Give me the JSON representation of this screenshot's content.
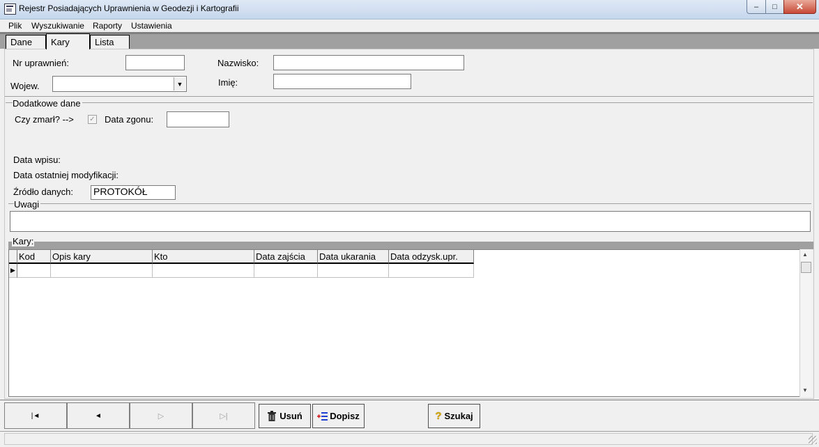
{
  "window": {
    "title": "Rejestr Posiadających Uprawnienia w Geodezji i Kartografii",
    "min": "–",
    "max": "□",
    "close": "✕"
  },
  "menu": [
    "Plik",
    "Wyszukiwanie",
    "Raporty",
    "Ustawienia"
  ],
  "tabs": [
    "Dane",
    "Kary",
    "Lista"
  ],
  "form": {
    "nr_uprawnien_label": "Nr uprawnień:",
    "nr_uprawnien_value": "",
    "nazwisko_label": "Nazwisko:",
    "nazwisko_value": "",
    "wojew_label": "Wojew.",
    "wojew_value": "",
    "imie_label": "Imię:",
    "imie_value": ""
  },
  "dodatkowe": {
    "legend": "Dodatkowe dane",
    "czy_zmarl_label": "Czy zmarł? -->",
    "czy_zmarl_checked": true,
    "data_zgonu_label": "Data zgonu:",
    "data_zgonu_value": "",
    "data_wpisu_label": "Data wpisu:",
    "data_modyfikacji_label": "Data ostatniej modyfikacji:",
    "zrodlo_label": "Źródło danych:",
    "zrodlo_value": "PROTOKÓŁ"
  },
  "uwagi": {
    "legend": "Uwagi",
    "value": ""
  },
  "kary": {
    "legend": "Kary:",
    "columns": [
      "Kod",
      "Opis kary",
      "Kto",
      "Data zajścia",
      "Data ukarania",
      "Data odzysk.upr."
    ],
    "rows": [
      [
        "",
        "",
        "",
        "",
        "",
        ""
      ]
    ]
  },
  "nav": {
    "first": "|◄",
    "prev": "◄",
    "next": "▷",
    "last": "▷|"
  },
  "buttons": {
    "usun": "Usuń",
    "dopisz": "Dopisz",
    "szukaj": "Szukaj"
  },
  "icons": {
    "usun": "trash-icon",
    "dopisz": "add-record-icon",
    "szukaj": "question-icon"
  }
}
